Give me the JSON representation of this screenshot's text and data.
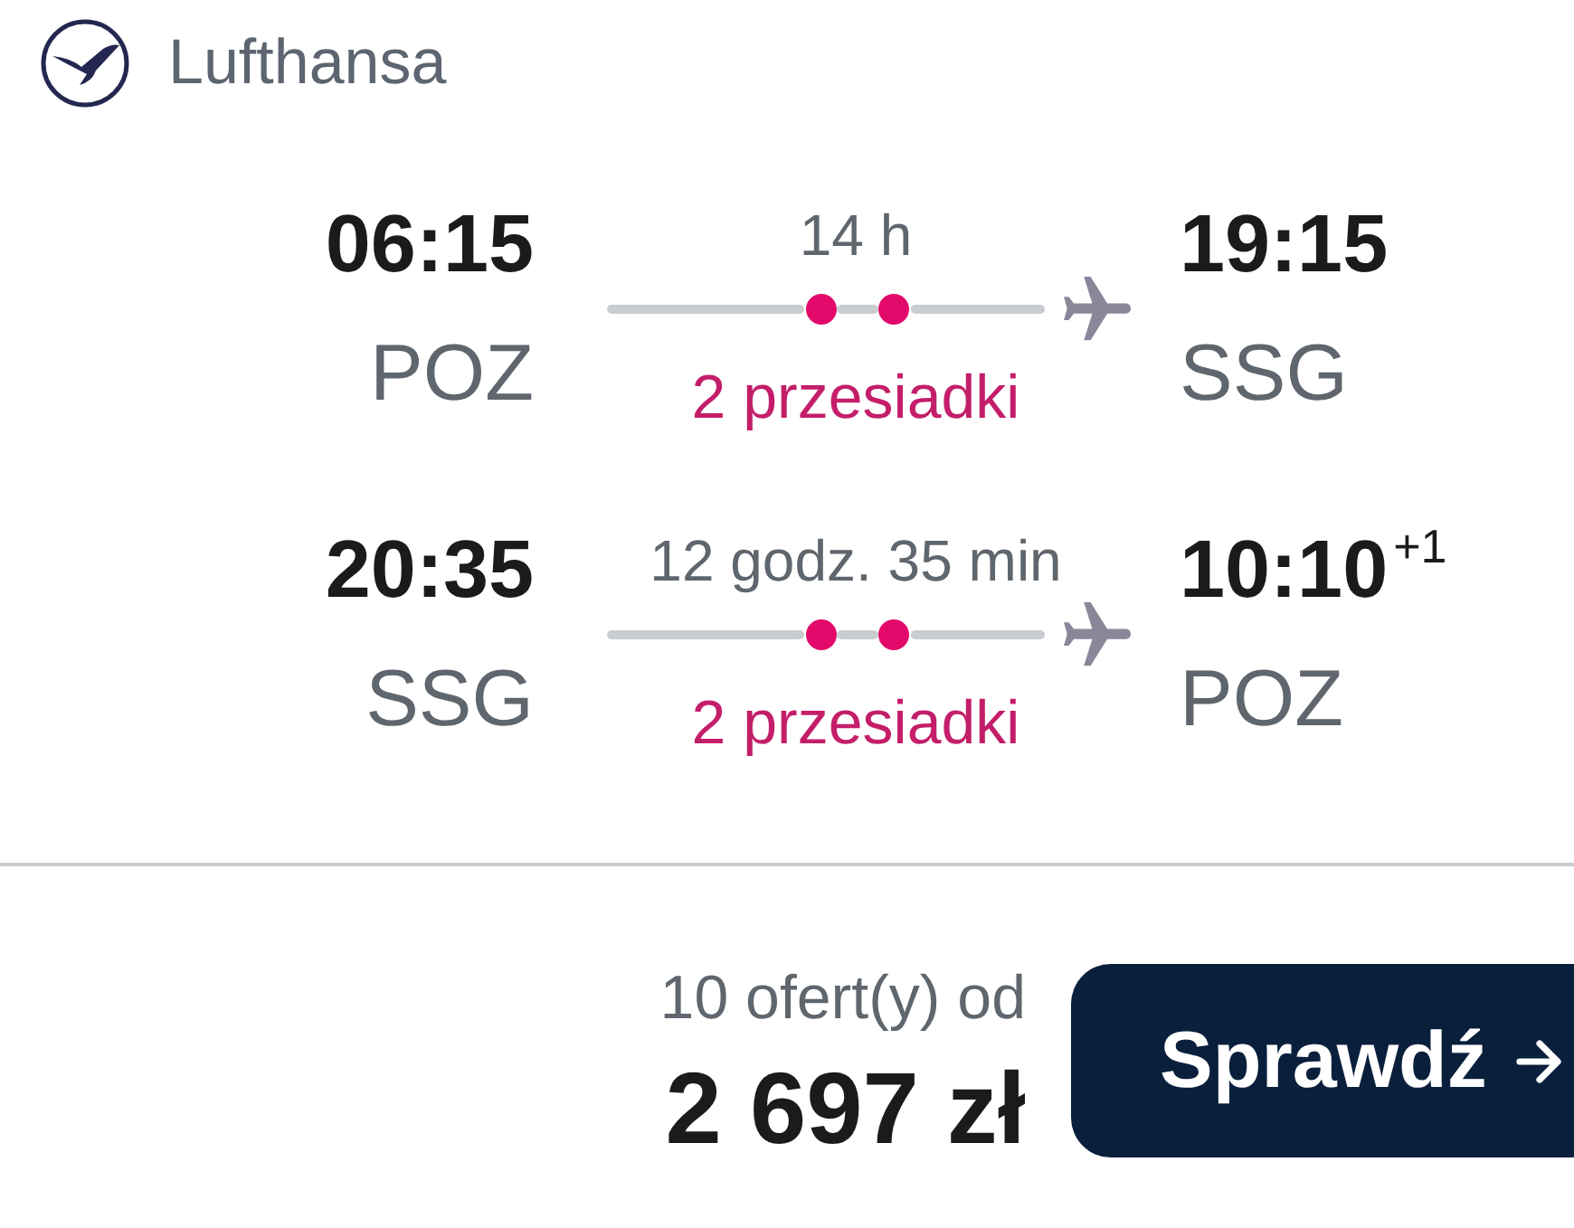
{
  "airline": {
    "name": "Lufthansa"
  },
  "legs": [
    {
      "departure": {
        "time": "06:15",
        "airport": "POZ"
      },
      "duration": "14 h",
      "stops_label": "2 przesiadki",
      "arrival": {
        "time": "19:15",
        "airport": "SSG"
      }
    },
    {
      "departure": {
        "time": "20:35",
        "airport": "SSG"
      },
      "duration": "12 godz. 35 min",
      "stops_label": "2 przesiadki",
      "arrival": {
        "time": "10:10",
        "day_offset": "+1",
        "airport": "POZ"
      }
    }
  ],
  "offer": {
    "count_label": "10 ofert(y) od",
    "price": "2 697 zł",
    "button": {
      "label": "Sprawdź"
    }
  }
}
